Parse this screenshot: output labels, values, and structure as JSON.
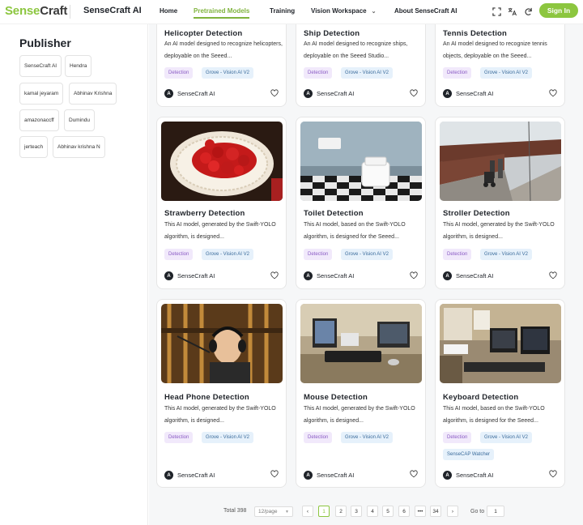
{
  "header": {
    "logo_part1": "Sense",
    "logo_part2": "Craft",
    "brand": "SenseCraft AI",
    "nav": [
      "Home",
      "Pretrained Models",
      "Training",
      "Vision Workspace",
      "About SenseCraft AI"
    ],
    "active_nav": "Pretrained Models",
    "signin_label": "Sign In",
    "icons": [
      "fullscreen-icon",
      "translate-icon",
      "refresh-icon"
    ]
  },
  "sidebar": {
    "title": "Publisher",
    "publishers": [
      "SenseCraft AI",
      "Hendra",
      "kamal jeyaram",
      "Abhinav Krishna",
      "amazonaccff",
      "Dumindu",
      "jerteach",
      "Abhinav krishna N"
    ]
  },
  "cards": [
    {
      "title": "Helicopter Detection",
      "desc": "An AI model designed to recognize helicopters, deployable on the Seeed...",
      "tags": [
        "Detection",
        "Grove - Vision AI V2"
      ],
      "author": "SenseCraft AI"
    },
    {
      "title": "Ship Detection",
      "desc": "An AI model designed to recognize ships, deployable on the Seeed Studio...",
      "tags": [
        "Detection",
        "Grove - Vision AI V2"
      ],
      "author": "SenseCraft AI"
    },
    {
      "title": "Tennis Detection",
      "desc": "An AI model designed to recognize tennis objects, deployable on the Seeed...",
      "tags": [
        "Detection",
        "Grove - Vision AI V2"
      ],
      "author": "SenseCraft AI"
    },
    {
      "title": "Strawberry Detection",
      "desc": "This AI model, generated by the Swift-YOLO algorithm, is designed...",
      "tags": [
        "Detection",
        "Grove - Vision AI V2"
      ],
      "author": "SenseCraft AI"
    },
    {
      "title": "Toilet Detection",
      "desc": "This AI model, based on the Swift-YOLO algorithm, is designed for the Seeed...",
      "tags": [
        "Detection",
        "Grove - Vision AI V2"
      ],
      "author": "SenseCraft AI"
    },
    {
      "title": "Stroller Detection",
      "desc": "This AI model, generated by the Swift-YOLO algorithm, is designed...",
      "tags": [
        "Detection",
        "Grove - Vision AI V2"
      ],
      "author": "SenseCraft AI"
    },
    {
      "title": "Head Phone Detection",
      "desc": "This AI model, generated by the Swift-YOLO algorithm, is designed...",
      "tags": [
        "Detection",
        "Grove - Vision AI V2"
      ],
      "author": "SenseCraft AI"
    },
    {
      "title": "Mouse Detection",
      "desc": "This AI model, generated by the Swift-YOLO algorithm, is designed...",
      "tags": [
        "Detection",
        "Grove - Vision AI V2"
      ],
      "author": "SenseCraft AI"
    },
    {
      "title": "Keyboard Detection",
      "desc": "This AI model, based on the Swift-YOLO algorithm, is designed for the Seeed...",
      "tags": [
        "Detection",
        "Grove - Vision AI V2",
        "SenseCAP Watcher"
      ],
      "author": "SenseCraft AI"
    }
  ],
  "pagination": {
    "total_label": "Total 398",
    "page_size": "12/page",
    "prev_icon": "chevron-left-icon",
    "pages": [
      "1",
      "2",
      "3",
      "4",
      "5",
      "6",
      "•••",
      "34"
    ],
    "current_page": "1",
    "next_icon": "chevron-right-icon",
    "goto_label": "Go to",
    "goto_value": "1"
  },
  "colors": {
    "accent": "#8cc63f",
    "detection_tag_bg": "#f1e9fb",
    "device_tag_bg": "#e6f1fb"
  }
}
